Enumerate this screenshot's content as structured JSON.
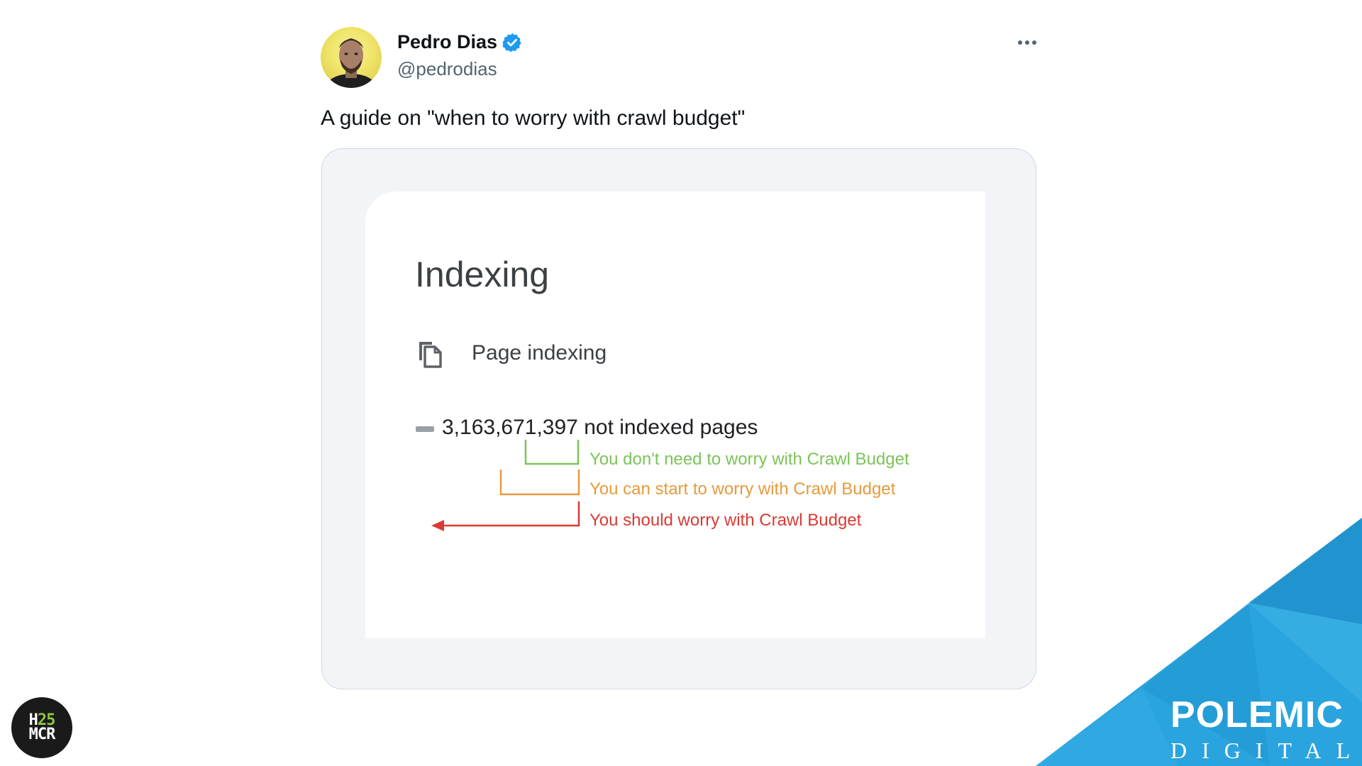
{
  "tweet": {
    "author_name": "Pedro Dias",
    "author_handle": "@pedrodias",
    "text": "A guide on \"when to worry with crawl budget\"",
    "icons": {
      "avatar": "profile-photo",
      "verified": "verified-badge-icon",
      "more": "more-options-icon"
    },
    "colors": {
      "verified": "#1d9bf0"
    }
  },
  "media": {
    "title": "Indexing",
    "section_label": "Page indexing",
    "section_icon": "copy-pages-icon",
    "count": "3,163,671,397",
    "count_suffix": "not indexed pages",
    "annotations": [
      {
        "text": "You don't need to worry with Crawl Budget",
        "color": "#7cc35a"
      },
      {
        "text": "You can start to worry with Crawl Budget",
        "color": "#e79a3c"
      },
      {
        "text": "You should worry with Crawl Budget",
        "color": "#d93a34"
      }
    ]
  },
  "logos": {
    "h25_line1_a": "H",
    "h25_line1_b": "25",
    "h25_line2": "MCR",
    "brand_name": "POLEMIC",
    "brand_sub": "DIGITAL",
    "colors": {
      "h25_accent": "#8dc63f",
      "brand_blue": "#2aa4de"
    }
  }
}
